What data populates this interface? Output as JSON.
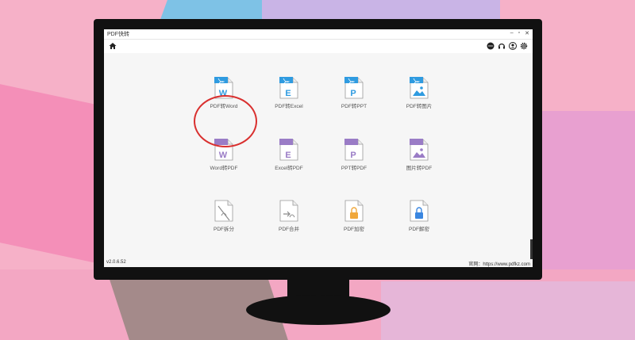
{
  "window": {
    "title": "PDF快转",
    "minimize": "–",
    "restore": "▫",
    "close": "✕"
  },
  "toolbar": {
    "home_icon": "home-icon",
    "right_icons": [
      "chat-icon",
      "headset-icon",
      "user-icon",
      "gear-icon"
    ]
  },
  "tiles": [
    {
      "label": "PDF转Word",
      "letter": "W",
      "color": "#2f9be0"
    },
    {
      "label": "PDF转Excel",
      "letter": "E",
      "color": "#2f9be0"
    },
    {
      "label": "PDF转PPT",
      "letter": "P",
      "color": "#2f9be0"
    },
    {
      "label": "PDF转图片",
      "letter": "",
      "color": "#2f9be0"
    },
    {
      "label": "Word转PDF",
      "letter": "W",
      "color": "#9a7cc6"
    },
    {
      "label": "Excel转PDF",
      "letter": "E",
      "color": "#9a7cc6"
    },
    {
      "label": "PPT转PDF",
      "letter": "P",
      "color": "#9a7cc6"
    },
    {
      "label": "图片转PDF",
      "letter": "",
      "color": "#9a7cc6"
    },
    {
      "label": "PDF拆分",
      "letter": "",
      "color": "#8a8a8a"
    },
    {
      "label": "PDF合并",
      "letter": "",
      "color": "#8a8a8a"
    },
    {
      "label": "PDF加密",
      "letter": "",
      "color": "#f0a73a"
    },
    {
      "label": "PDF解密",
      "letter": "",
      "color": "#3a86e0"
    }
  ],
  "status": {
    "version": "v2.0.6.52",
    "website": "官网：https://www.pdfkz.com"
  }
}
